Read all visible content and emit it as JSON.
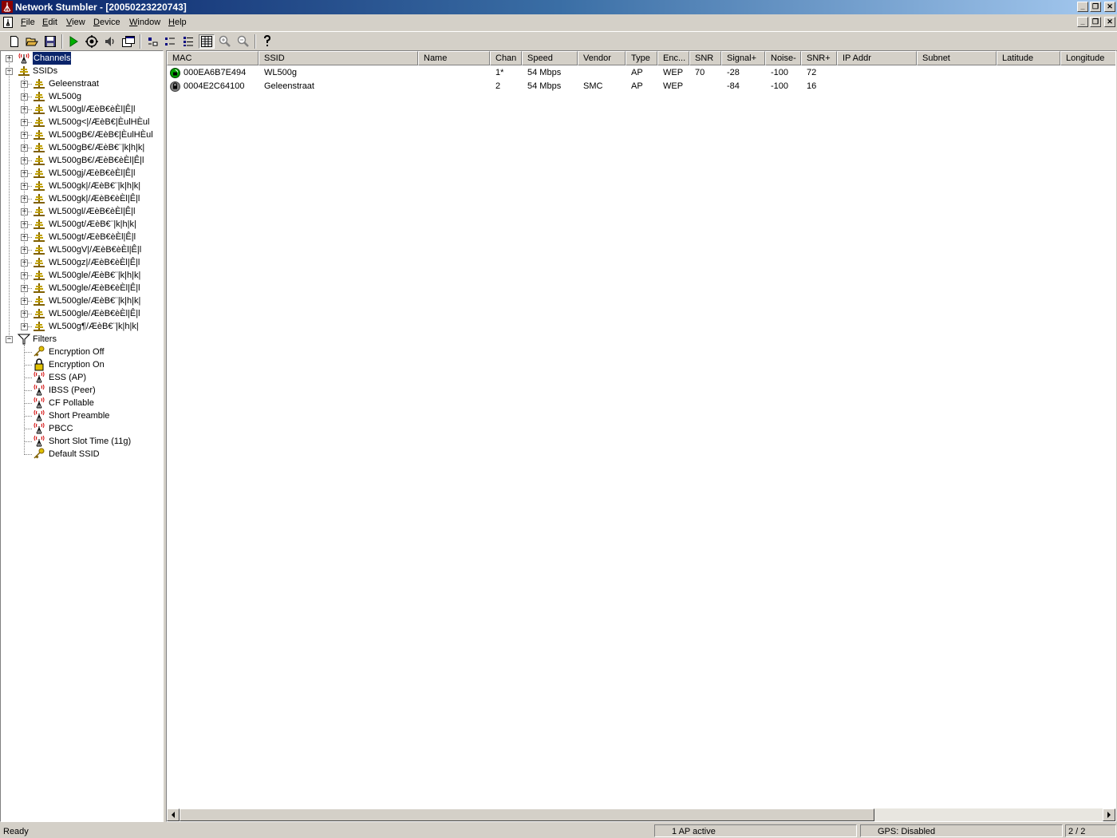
{
  "window": {
    "title": "Network Stumbler - [20050223220743]"
  },
  "menu": {
    "items": [
      {
        "label": "File",
        "key": "F",
        "rest": "ile"
      },
      {
        "label": "Edit",
        "key": "E",
        "rest": "dit"
      },
      {
        "label": "View",
        "key": "V",
        "rest": "iew"
      },
      {
        "label": "Device",
        "key": "D",
        "rest": "evice"
      },
      {
        "label": "Window",
        "key": "W",
        "rest": "indow"
      },
      {
        "label": "Help",
        "key": "H",
        "rest": "elp"
      }
    ]
  },
  "toolbar": {
    "buttons": [
      "new-icon",
      "open-icon",
      "save-icon",
      "play-icon",
      "auto-configure-icon",
      "speaker-icon",
      "properties-icon",
      "large-icons-icon",
      "small-icons-icon",
      "list-view-icon",
      "details-view-icon",
      "zoom-in-icon",
      "zoom-out-icon",
      "help-icon"
    ]
  },
  "tree": {
    "channels": "Channels",
    "ssids": "SSIDs",
    "ssid_items": [
      "Geleenstraat",
      "WL500g",
      "WL500gl/ÆèB€èÈl|Ê|l",
      "WL500g<|/ÆèB€|ÈulHÈul",
      "WL500gB€/ÆèB€|ÈulHÈul",
      "WL500gB€/ÆèB€¨|k|h|k|",
      "WL500gB€/ÆèB€èÈl|Ê|l",
      "WL500gj/ÆèB€èÈl|Ê|l",
      "WL500gk|/ÆèB€¨|k|h|k|",
      "WL500gk|/ÆèB€èÈl|Ê|l",
      "WL500gl/ÆèB€èÈl|Ê|l",
      "WL500gt/ÆèB€¨|k|h|k|",
      "WL500gt/ÆèB€èÈl|Ê|l",
      "WL500gV|/ÆèB€èÈl|Ê|l",
      "WL500gz|/ÆèB€èÈl|Ê|l",
      "WL500gle/ÆèB€¨|k|h|k|",
      "WL500gle/ÆèB€èÈl|Ê|l",
      "WL500gle/ÆèB€¨|k|h|k|",
      "WL500gle/ÆèB€èÈl|Ê|l",
      "WL500g¶/ÆèB€¨|k|h|k|"
    ],
    "filters": "Filters",
    "filter_items": [
      {
        "label": "Encryption Off",
        "icon": "key-icon"
      },
      {
        "label": "Encryption On",
        "icon": "lock-icon"
      },
      {
        "label": "ESS (AP)",
        "icon": "antenna-icon"
      },
      {
        "label": "IBSS (Peer)",
        "icon": "antenna-icon"
      },
      {
        "label": "CF Pollable",
        "icon": "antenna-icon"
      },
      {
        "label": "Short Preamble",
        "icon": "antenna-icon"
      },
      {
        "label": "PBCC",
        "icon": "antenna-icon"
      },
      {
        "label": "Short Slot Time (11g)",
        "icon": "antenna-icon"
      },
      {
        "label": "Default SSID",
        "icon": "key-icon"
      }
    ]
  },
  "list": {
    "columns": [
      "MAC",
      "SSID",
      "Name",
      "Chan",
      "Speed",
      "Vendor",
      "Type",
      "Enc...",
      "SNR",
      "Signal+",
      "Noise-",
      "SNR+",
      "IP Addr",
      "Subnet",
      "Latitude",
      "Longitude"
    ],
    "rows": [
      {
        "status": "active",
        "status_color": "#00a000",
        "mac": "000EA6B7E494",
        "ssid": "WL500g",
        "name": "",
        "chan": "1*",
        "speed": "54 Mbps",
        "vendor": "",
        "type": "AP",
        "enc": "WEP",
        "snr": "70",
        "signal": "-28",
        "noise": "-100",
        "snr_plus": "72",
        "ip": "",
        "subnet": "",
        "lat": "",
        "lon": ""
      },
      {
        "status": "inactive",
        "status_color": "#808080",
        "mac": "0004E2C64100",
        "ssid": "Geleenstraat",
        "name": "",
        "chan": "2",
        "speed": "54 Mbps",
        "vendor": "SMC",
        "type": "AP",
        "enc": "WEP",
        "snr": "",
        "signal": "-84",
        "noise": "-100",
        "snr_plus": "16",
        "ip": "",
        "subnet": "",
        "lat": "",
        "lon": ""
      }
    ]
  },
  "status": {
    "ready": "Ready",
    "ap_active": "1 AP active",
    "gps": "GPS: Disabled",
    "count": "2 / 2"
  }
}
